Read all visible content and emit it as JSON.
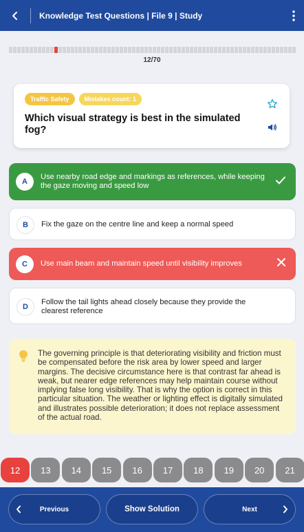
{
  "header": {
    "title": "Knowledge Test Questions | File 9 | Study",
    "back_icon": "chevron-left-icon",
    "menu_icon": "more-vertical-icon"
  },
  "progress": {
    "label": "12/70",
    "current": 12,
    "total": 70,
    "wrong_question": 12
  },
  "question": {
    "category_badge": "Traffic Safety",
    "mistakes_badge": "Mistakes count: 1",
    "text": "Which visual strategy is best in the simulated fog?",
    "icons": [
      "star-icon",
      "speaker-icon"
    ]
  },
  "options": [
    {
      "letter": "A",
      "text": "Use nearby road edge and markings as references, while keeping the gaze moving and speed low",
      "state": "correct"
    },
    {
      "letter": "B",
      "text": "Fix the gaze on the centre line and keep a normal speed",
      "state": "neutral"
    },
    {
      "letter": "C",
      "text": "Use main beam and maintain speed until visibility improves",
      "state": "wrong"
    },
    {
      "letter": "D",
      "text": "Follow the tail lights ahead closely because they provide the clearest reference",
      "state": "neutral"
    }
  ],
  "explanation": {
    "icon": "lightbulb-icon",
    "text": "The governing principle is that deteriorating visibility and friction must be compensated before the risk area by lower speed and larger margins. The decisive circumstance here is that contrast far ahead is weak, but nearer edge references may help maintain course without implying false long visibility. That is why the option is correct in this particular situation. The weather or lighting effect is digitally simulated and illustrates possible deterioration; it does not replace assessment of the actual road."
  },
  "question_numbers": [
    "12",
    "13",
    "14",
    "15",
    "16",
    "17",
    "18",
    "19",
    "20",
    "21"
  ],
  "navigation": {
    "previous_label": "Previous",
    "solution_label": "Show Solution",
    "next_label": "Next"
  },
  "colors": {
    "primary": "#1f4a9e",
    "correct": "#3a9a41",
    "wrong": "#ee5a57",
    "badge": "#f5c542",
    "explanation_bg": "#fcf6cf"
  }
}
